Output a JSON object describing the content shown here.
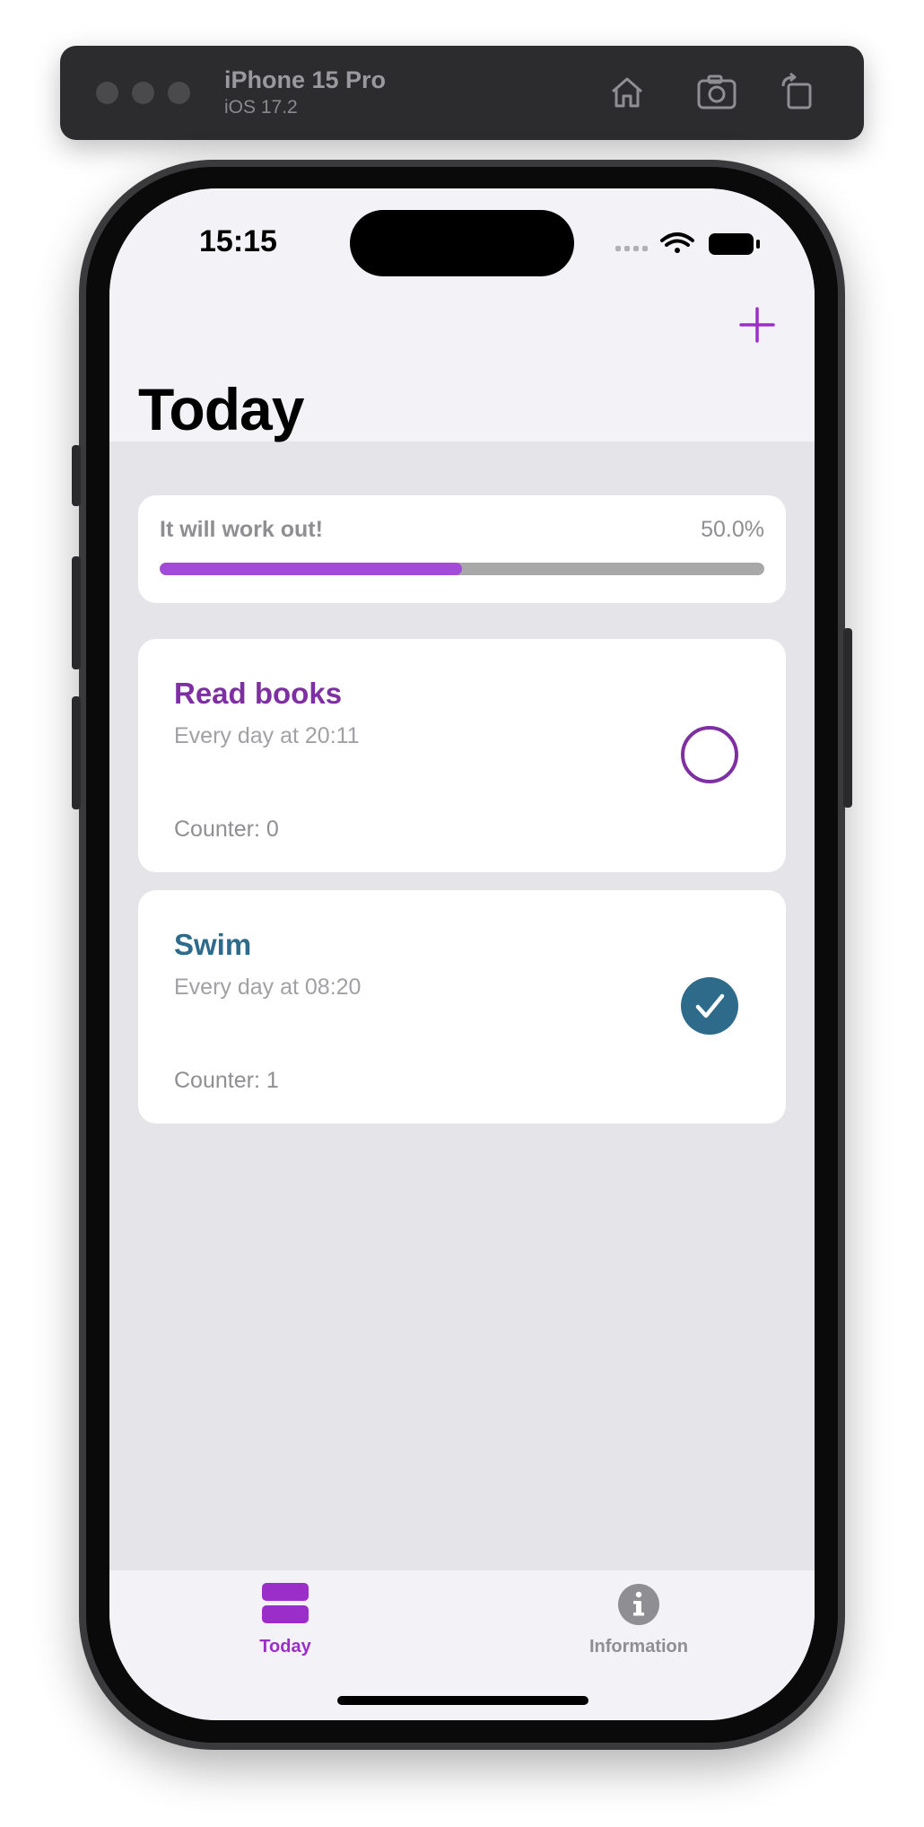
{
  "simulator": {
    "device": "iPhone 15 Pro",
    "os": "iOS 17.2",
    "icons": [
      "home-icon",
      "screenshot-icon",
      "rotate-icon"
    ]
  },
  "status_bar": {
    "time": "15:15",
    "icons": [
      "signal-icon",
      "wifi-icon",
      "battery-icon"
    ]
  },
  "nav": {
    "title": "Today",
    "add_icon": "plus-icon"
  },
  "progress": {
    "label": "It will work out!",
    "value_text": "50.0%",
    "fraction": 0.5,
    "fill_color": "#a24bd8",
    "track_color": "#a8a8a8"
  },
  "habits": [
    {
      "name": "Read books",
      "schedule": "Every day at 20:11",
      "counter": "Counter: 0",
      "color": "#7e2fa1",
      "done": false
    },
    {
      "name": "Swim",
      "schedule": "Every day at 08:20",
      "counter": "Counter: 1",
      "color": "#2e6a8a",
      "done": true
    }
  ],
  "tabs": [
    {
      "label": "Today",
      "icon": "list-icon",
      "active": true,
      "color": "#9b2ec9"
    },
    {
      "label": "Information",
      "icon": "info-icon",
      "active": false,
      "color": "#8e8e93"
    }
  ]
}
